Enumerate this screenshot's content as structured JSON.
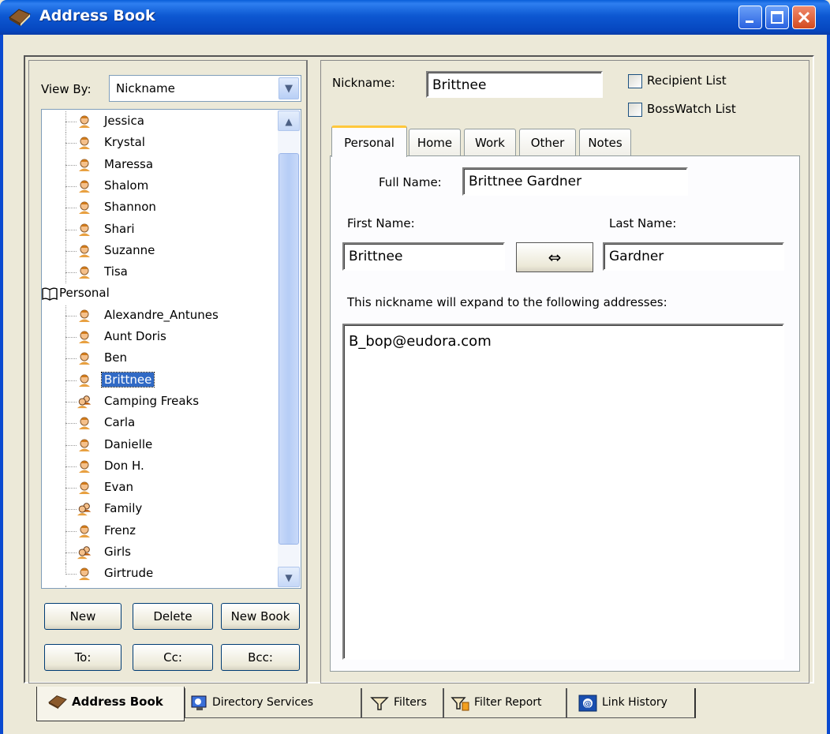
{
  "window": {
    "title": "Address Book",
    "controls": [
      "minimize",
      "maximize",
      "close"
    ]
  },
  "left_pane": {
    "view_by_label": "View By:",
    "view_by_value": "Nickname",
    "tree": [
      {
        "label": "Jessica",
        "icon": "person-icon",
        "type": "contact"
      },
      {
        "label": "Krystal",
        "icon": "person-icon",
        "type": "contact"
      },
      {
        "label": "Maressa",
        "icon": "person-icon",
        "type": "contact"
      },
      {
        "label": "Shalom",
        "icon": "person-icon",
        "type": "contact"
      },
      {
        "label": "Shannon",
        "icon": "person-icon",
        "type": "contact"
      },
      {
        "label": "Shari",
        "icon": "person-icon",
        "type": "contact"
      },
      {
        "label": "Suzanne",
        "icon": "person-icon",
        "type": "contact"
      },
      {
        "label": "Tisa",
        "icon": "person-icon",
        "type": "contact"
      },
      {
        "label": "Personal",
        "icon": "book-icon",
        "type": "book"
      },
      {
        "label": "Alexandre_Antunes",
        "icon": "person-icon",
        "type": "contact"
      },
      {
        "label": "Aunt Doris",
        "icon": "person-icon",
        "type": "contact"
      },
      {
        "label": "Ben",
        "icon": "person-icon",
        "type": "contact"
      },
      {
        "label": "Brittnee",
        "icon": "person-icon",
        "type": "contact",
        "selected": true
      },
      {
        "label": "Camping Freaks",
        "icon": "group-icon",
        "type": "group"
      },
      {
        "label": "Carla",
        "icon": "person-icon",
        "type": "contact"
      },
      {
        "label": "Danielle",
        "icon": "person-icon",
        "type": "contact"
      },
      {
        "label": "Don H.",
        "icon": "person-icon",
        "type": "contact"
      },
      {
        "label": "Evan",
        "icon": "person-icon",
        "type": "contact"
      },
      {
        "label": "Family",
        "icon": "group-icon",
        "type": "group"
      },
      {
        "label": "Frenz",
        "icon": "person-icon",
        "type": "contact"
      },
      {
        "label": "Girls",
        "icon": "group-icon",
        "type": "group"
      },
      {
        "label": "Girtrude",
        "icon": "person-icon",
        "type": "contact"
      }
    ],
    "buttons": {
      "new": "New",
      "delete": "Delete",
      "new_book": "New Book",
      "to": "To:",
      "cc": "Cc:",
      "bcc": "Bcc:"
    }
  },
  "right_pane": {
    "nickname_label": "Nickname:",
    "nickname_value": "Brittnee",
    "recipient_list_label": "Recipient List",
    "bosswatch_list_label": "BossWatch List",
    "tabs": [
      "Personal",
      "Home",
      "Work",
      "Other",
      "Notes"
    ],
    "active_tab": "Personal",
    "full_name_label": "Full Name:",
    "full_name_value": "Brittnee Gardner",
    "first_name_label": "First Name:",
    "first_name_value": "Brittnee",
    "last_name_label": "Last Name:",
    "last_name_value": "Gardner",
    "swap_symbol": "⇔",
    "expand_label": "This nickname will expand to the following addresses:",
    "addresses": "B_bop@eudora.com"
  },
  "bottom_tabs": [
    {
      "label": "Address Book",
      "icon": "address-book-icon",
      "active": true
    },
    {
      "label": "Directory Services",
      "icon": "directory-services-icon"
    },
    {
      "label": "Filters",
      "icon": "filters-icon"
    },
    {
      "label": "Filter Report",
      "icon": "filter-report-icon"
    },
    {
      "label": "Link History",
      "icon": "link-history-icon"
    }
  ],
  "colors": {
    "titlebar": "#0a5ed8",
    "selection": "#316ac5",
    "background": "#ece9d8",
    "active_tab_accent": "#ffc83c"
  }
}
